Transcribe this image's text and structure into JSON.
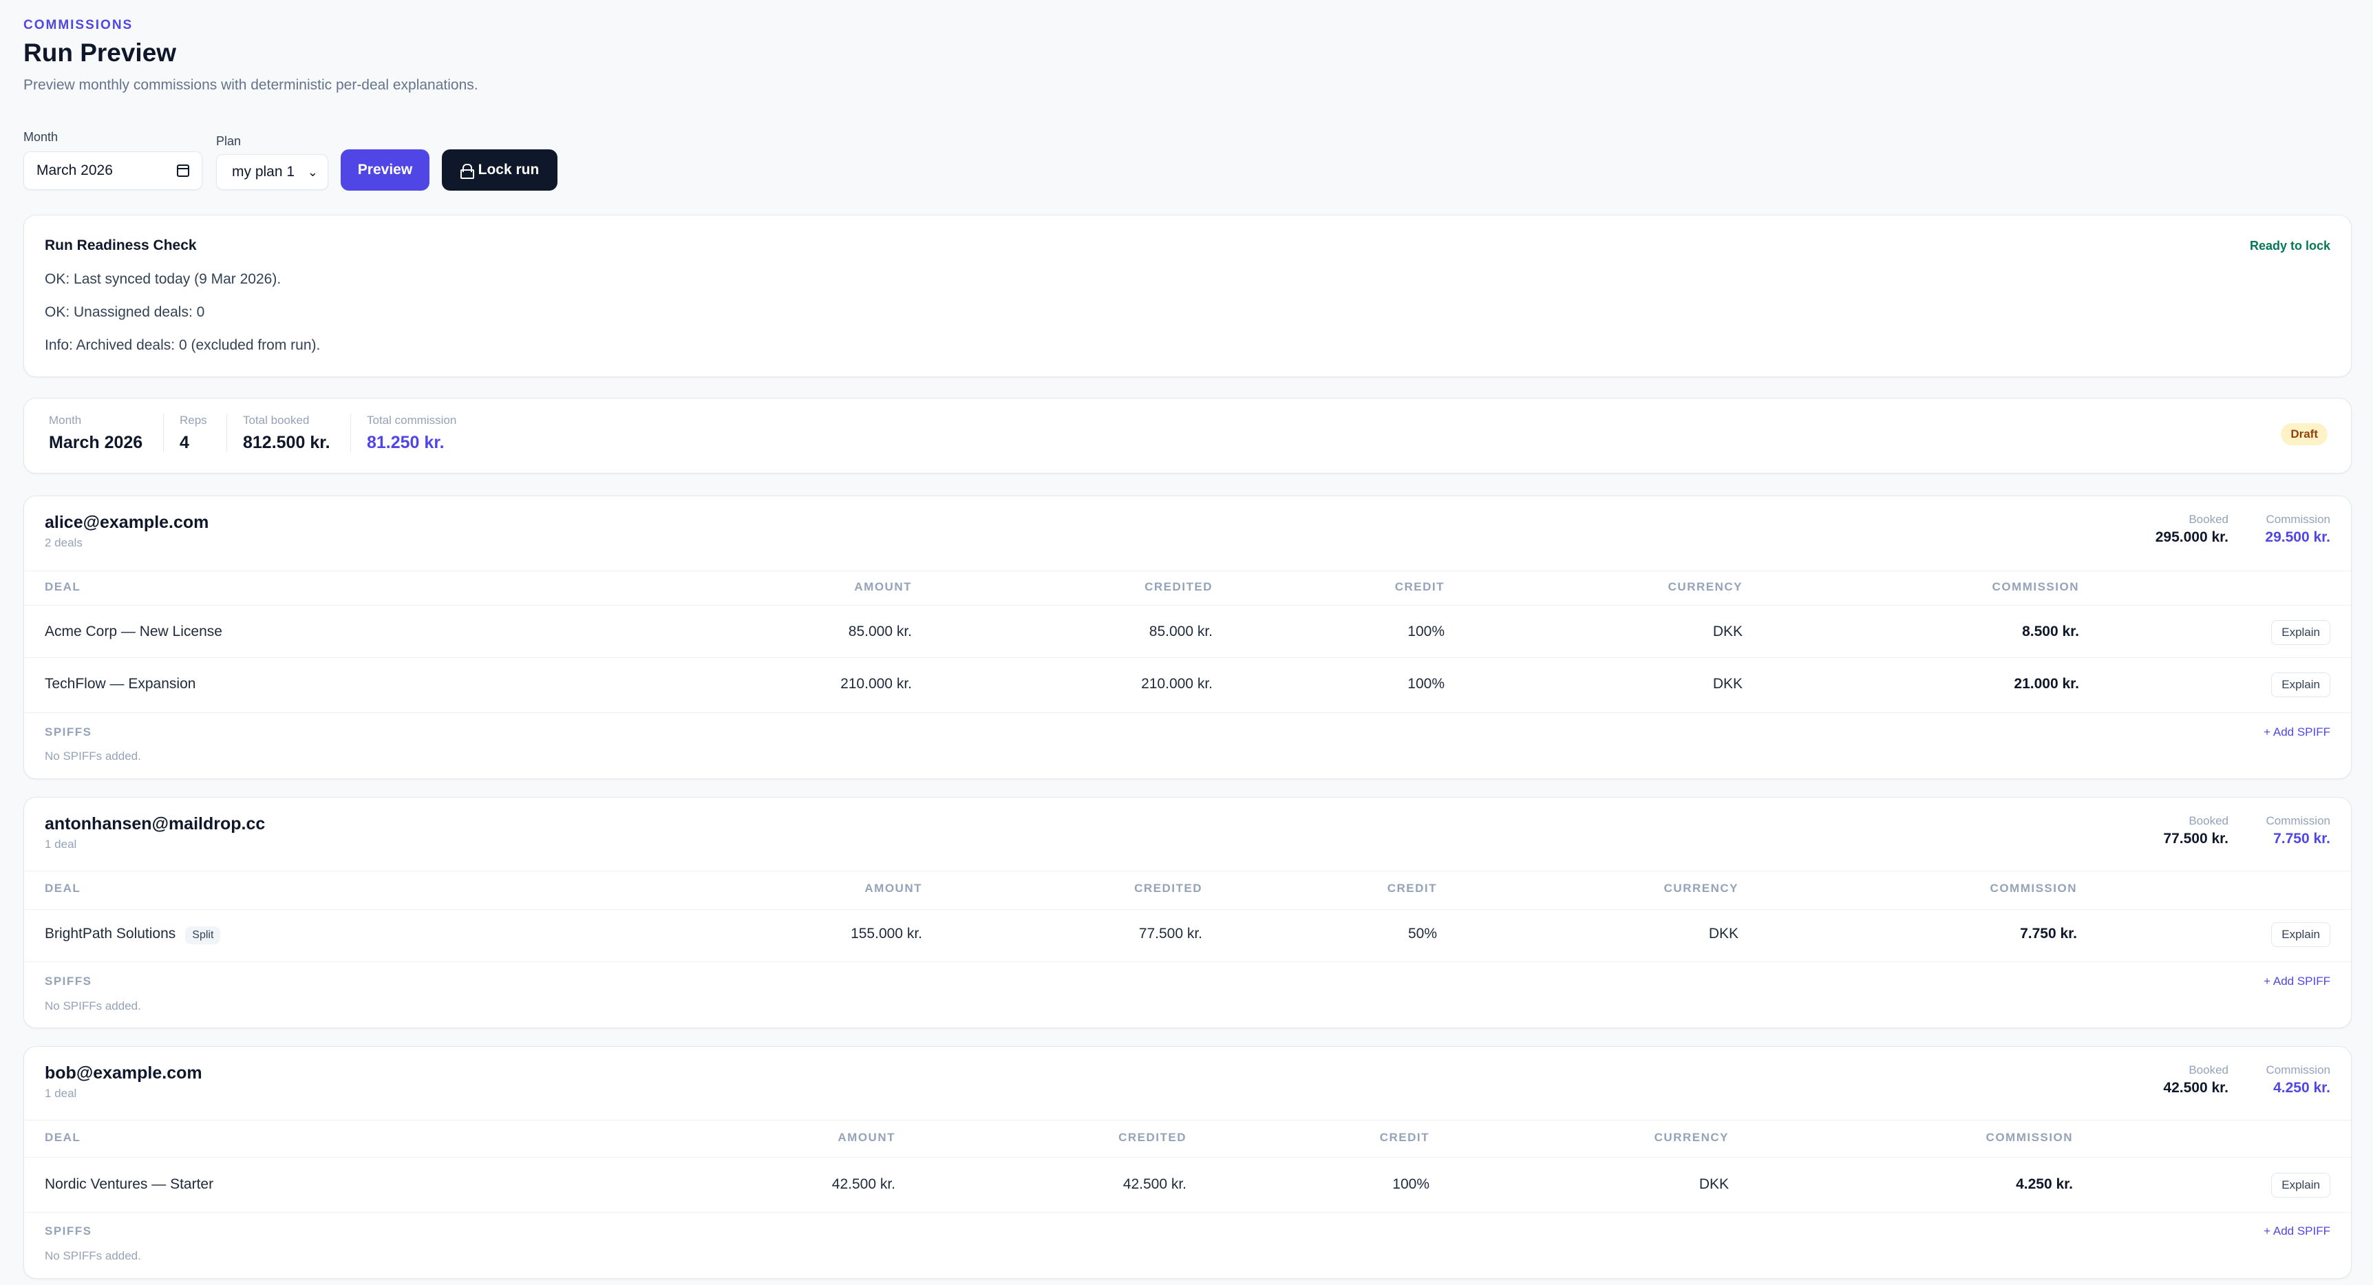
{
  "header": {
    "eyebrow": "COMMISSIONS",
    "title": "Run Preview",
    "subtitle": "Preview monthly commissions with deterministic per-deal explanations."
  },
  "controls": {
    "month_label": "Month",
    "month_value": "March 2026",
    "plan_label": "Plan",
    "plan_value": "my plan 1",
    "preview_label": "Preview",
    "lock_label": "Lock run"
  },
  "readiness": {
    "title": "Run Readiness Check",
    "status": "Ready to lock",
    "lines": [
      "OK: Last synced today (9 Mar 2026).",
      "OK: Unassigned deals: 0",
      "Info: Archived deals: 0 (excluded from run)."
    ]
  },
  "summary": {
    "month_label": "Month",
    "month_value": "March 2026",
    "reps_label": "Reps",
    "reps_value": "4",
    "booked_label": "Total booked",
    "booked_value": "812.500 kr.",
    "commission_label": "Total commission",
    "commission_value": "81.250 kr.",
    "status_badge": "Draft"
  },
  "table_headers": {
    "deal": "DEAL",
    "amount": "AMOUNT",
    "credited": "CREDITED",
    "credit": "CREDIT",
    "currency": "CURRENCY",
    "commission": "COMMISSION"
  },
  "labels": {
    "booked": "Booked",
    "commission": "Commission",
    "explain": "Explain",
    "spiffs": "SPIFFS",
    "no_spiffs": "No SPIFFs added.",
    "add_spiff": "+ Add SPIFF",
    "split": "Split"
  },
  "reps": [
    {
      "email": "alice@example.com",
      "deal_count": "2 deals",
      "booked": "295.000 kr.",
      "commission": "29.500 kr.",
      "deals": [
        {
          "name": "Acme Corp — New License",
          "amount": "85.000 kr.",
          "credited": "85.000 kr.",
          "credit": "100%",
          "currency": "DKK",
          "commission": "8.500 kr."
        },
        {
          "name": "TechFlow — Expansion",
          "amount": "210.000 kr.",
          "credited": "210.000 kr.",
          "credit": "100%",
          "currency": "DKK",
          "commission": "21.000 kr."
        }
      ]
    },
    {
      "email": "antonhansen@maildrop.cc",
      "deal_count": "1 deal",
      "booked": "77.500 kr.",
      "commission": "7.750 kr.",
      "deals": [
        {
          "name": "BrightPath Solutions",
          "amount": "155.000 kr.",
          "credited": "77.500 kr.",
          "credit": "50%",
          "currency": "DKK",
          "commission": "7.750 kr."
        }
      ]
    },
    {
      "email": "bob@example.com",
      "deal_count": "1 deal",
      "booked": "42.500 kr.",
      "commission": "4.250 kr.",
      "deals": [
        {
          "name": "Nordic Ventures — Starter",
          "amount": "42.500 kr.",
          "credited": "42.500 kr.",
          "credit": "100%",
          "currency": "DKK",
          "commission": "4.250 kr."
        }
      ]
    }
  ]
}
